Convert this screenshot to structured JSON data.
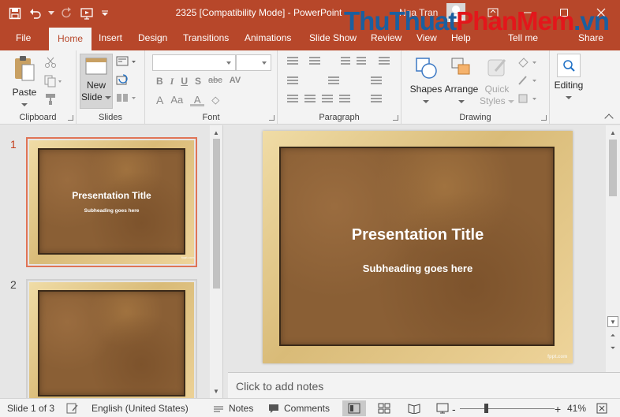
{
  "titlebar": {
    "title": "2325 [Compatibility Mode]  -  PowerPoint",
    "user": "Nga Tran",
    "watermark_part1": "ThuThuat",
    "watermark_part2": "PhanMem",
    "watermark_part3": ".vn"
  },
  "tabs": [
    "File",
    "Home",
    "Insert",
    "Design",
    "Transitions",
    "Animations",
    "Slide Show",
    "Review",
    "View",
    "Help",
    "Tell me",
    "Share"
  ],
  "ribbon": {
    "clipboard": {
      "paste": "Paste",
      "label": "Clipboard"
    },
    "slides": {
      "new_slide_1": "New",
      "new_slide_2": "Slide",
      "label": "Slides"
    },
    "font": {
      "label": "Font",
      "bold": "B",
      "italic": "I",
      "underline": "U",
      "shadow": "S",
      "strike": "abc",
      "spacing": "AV",
      "grow": "A",
      "case": "Aa"
    },
    "paragraph": {
      "label": "Paragraph"
    },
    "drawing": {
      "shapes": "Shapes",
      "arrange": "Arrange",
      "quick_1": "Quick",
      "quick_2": "Styles",
      "label": "Drawing"
    },
    "editing": {
      "label": "Editing"
    }
  },
  "slides": [
    {
      "number": "1",
      "title": "Presentation Title",
      "subtitle": "Subheading goes here",
      "brand": "fppt.com"
    },
    {
      "number": "2"
    }
  ],
  "main_slide": {
    "title": "Presentation Title",
    "subtitle": "Subheading goes here",
    "brand": "fppt.com"
  },
  "notes": {
    "placeholder": "Click to add notes"
  },
  "status": {
    "slide_info": "Slide 1 of 3",
    "language": "English (United States)",
    "notes": "Notes",
    "comments": "Comments",
    "zoom_minus": "-",
    "zoom_plus": "+",
    "zoom": "41%"
  },
  "colors": {
    "accent": "#b7472a",
    "selection": "#e07456",
    "frame": "#e3c98c",
    "cork": "#8a5f35"
  }
}
